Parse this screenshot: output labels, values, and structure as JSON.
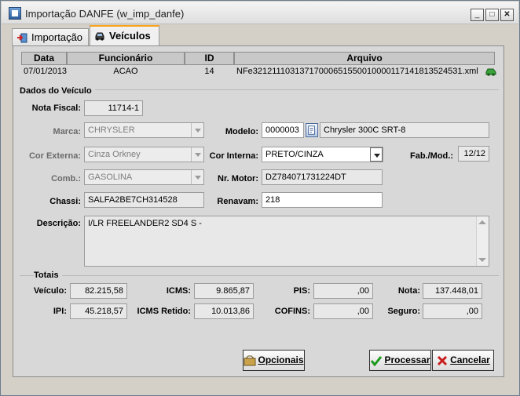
{
  "window": {
    "title": "Importação DANFE (w_imp_danfe)",
    "minimize": "_",
    "maximize": "□",
    "close": "✕"
  },
  "tabs": [
    {
      "label": "Importação",
      "icon": "import-icon",
      "active": false
    },
    {
      "label": "Veículos",
      "icon": "vehicle-icon",
      "active": true
    }
  ],
  "grid": {
    "columns": [
      "Data",
      "Funcionário",
      "ID",
      "Arquivo"
    ],
    "rows": [
      {
        "data": "07/01/2013",
        "funcionario": "ACAO",
        "id": "14",
        "arquivo": "NFe32121110313717000651550010000117141813524531.xml"
      }
    ]
  },
  "dados": {
    "section_title": "Dados do Veículo",
    "nota_fiscal_label": "Nota Fiscal:",
    "nota_fiscal": "11714-1",
    "marca_label": "Marca:",
    "marca": "CHRYSLER",
    "modelo_label": "Modelo:",
    "modelo_codigo": "0000003",
    "modelo_desc": "Chrysler 300C SRT-8",
    "cor_externa_label": "Cor Externa:",
    "cor_externa": "Cinza Orkney",
    "cor_interna_label": "Cor Interna:",
    "cor_interna": "PRETO/CINZA",
    "fab_mod_label": "Fab./Mod.:",
    "fab_mod": "12/12",
    "comb_label": "Comb.:",
    "comb": "GASOLINA",
    "nr_motor_label": "Nr. Motor:",
    "nr_motor": "DZ784071731224DT",
    "chassi_label": "Chassi:",
    "chassi": "SALFA2BE7CH314528",
    "renavam_label": "Renavam:",
    "renavam": "218",
    "descricao_label": "Descrição:",
    "descricao": "I/LR FREELANDER2 SD4 S -"
  },
  "totais": {
    "section_title": "Totais",
    "veiculo_label": "Veículo:",
    "veiculo": "82.215,58",
    "icms_label": "ICMS:",
    "icms": "9.865,87",
    "pis_label": "PIS:",
    "pis": ",00",
    "nota_label": "Nota:",
    "nota": "137.448,01",
    "ipi_label": "IPI:",
    "ipi": "45.218,57",
    "icms_retido_label": "ICMS Retido:",
    "icms_retido": "10.013,86",
    "cofins_label": "COFINS:",
    "cofins": ",00",
    "seguro_label": "Seguro:",
    "seguro": ",00"
  },
  "buttons": {
    "opcionais": "Opcionais",
    "processar": "Processar",
    "cancelar": "Cancelar"
  },
  "colors": {
    "active_tab_accent": "#f7a21b",
    "window_bg": "#d4d0c8"
  }
}
